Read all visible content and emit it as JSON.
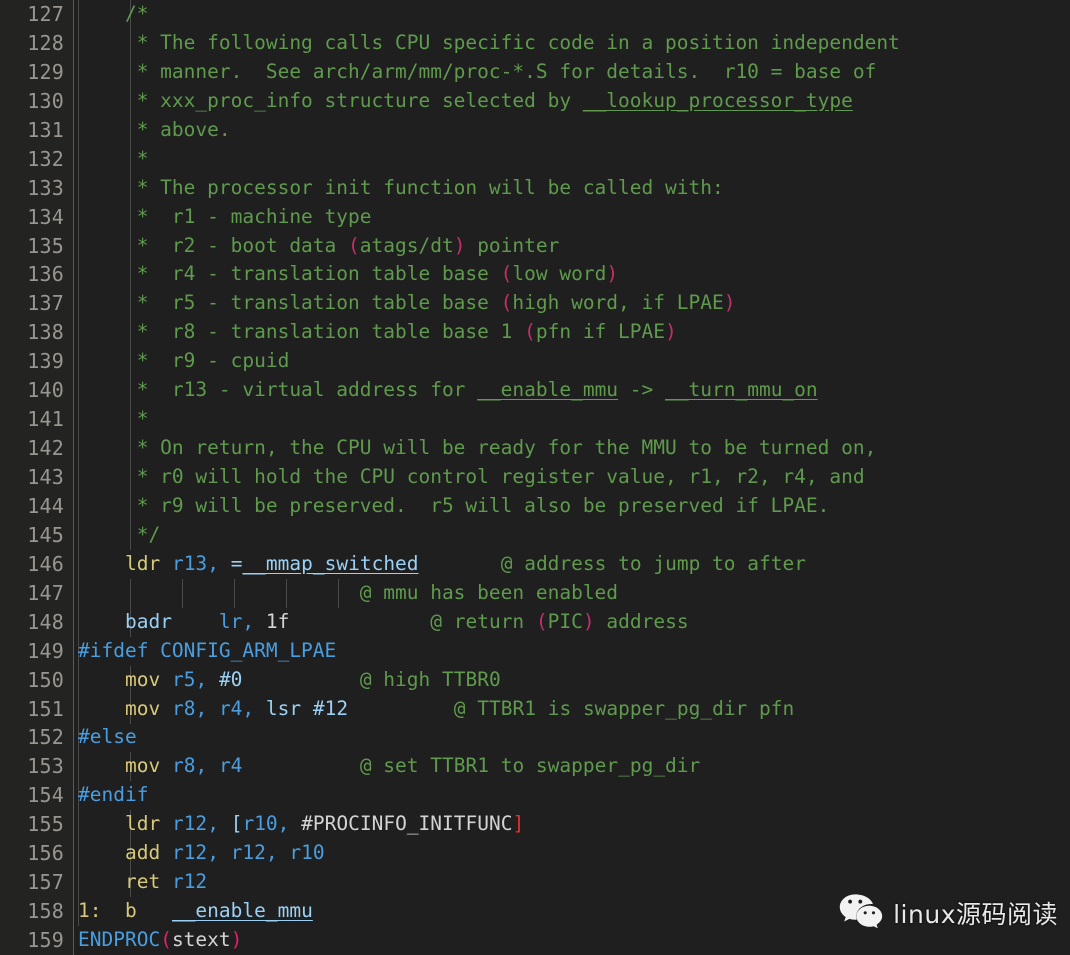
{
  "editor": {
    "theme_background": "#1e1f1e",
    "gutter_background": "#232422",
    "first_line": 127,
    "last_line": 159,
    "colors": {
      "comment": "#5f9a4d",
      "keyword": "#4a9ee0",
      "mnemonic": "#d8c97a",
      "register": "#4a9ee0",
      "identifier": "#9bd0f5",
      "paren_crimson": "#e0216b",
      "bracket_red": "#e03131",
      "plain": "#d4d4d4",
      "line_number": "#999691"
    }
  },
  "line_numbers": [
    127,
    128,
    129,
    130,
    131,
    132,
    133,
    134,
    135,
    136,
    137,
    138,
    139,
    140,
    141,
    142,
    143,
    144,
    145,
    146,
    147,
    148,
    149,
    150,
    151,
    152,
    153,
    154,
    155,
    156,
    157,
    158,
    159
  ],
  "lines": [
    {
      "n": 127,
      "text": "    /*"
    },
    {
      "n": 128,
      "text": "     * The following calls CPU specific code in a position independent"
    },
    {
      "n": 129,
      "text": "     * manner.  See arch/arm/mm/proc-*.S for details.  r10 = base of"
    },
    {
      "n": 130,
      "text": "     * xxx_proc_info structure selected by __lookup_processor_type"
    },
    {
      "n": 131,
      "text": "     * above."
    },
    {
      "n": 132,
      "text": "     *"
    },
    {
      "n": 133,
      "text": "     * The processor init function will be called with:"
    },
    {
      "n": 134,
      "text": "     *  r1 - machine type"
    },
    {
      "n": 135,
      "text": "     *  r2 - boot data (atags/dt) pointer"
    },
    {
      "n": 136,
      "text": "     *  r4 - translation table base (low word)"
    },
    {
      "n": 137,
      "text": "     *  r5 - translation table base (high word, if LPAE)"
    },
    {
      "n": 138,
      "text": "     *  r8 - translation table base 1 (pfn if LPAE)"
    },
    {
      "n": 139,
      "text": "     *  r9 - cpuid"
    },
    {
      "n": 140,
      "text": "     *  r13 - virtual address for __enable_mmu -> __turn_mmu_on"
    },
    {
      "n": 141,
      "text": "     *"
    },
    {
      "n": 142,
      "text": "     * On return, the CPU will be ready for the MMU to be turned on,"
    },
    {
      "n": 143,
      "text": "     * r0 will hold the CPU control register value, r1, r2, r4, and"
    },
    {
      "n": 144,
      "text": "     * r9 will be preserved.  r5 will also be preserved if LPAE."
    },
    {
      "n": 145,
      "text": "     */"
    },
    {
      "n": 146,
      "text": "    ldr r13, =__mmap_switched     @ address to jump to after"
    },
    {
      "n": 147,
      "text": "                      @ mmu has been enabled"
    },
    {
      "n": 148,
      "text": "    badr    lr, 1f            @ return (PIC) address"
    },
    {
      "n": 149,
      "text": "#ifdef CONFIG_ARM_LPAE"
    },
    {
      "n": 150,
      "text": "    mov r5, #0          @ high TTBR0"
    },
    {
      "n": 151,
      "text": "    mov r8, r4, lsr #12         @ TTBR1 is swapper_pg_dir pfn"
    },
    {
      "n": 152,
      "text": "#else"
    },
    {
      "n": 153,
      "text": "    mov r8, r4          @ set TTBR1 to swapper_pg_dir"
    },
    {
      "n": 154,
      "text": "#endif"
    },
    {
      "n": 155,
      "text": "    ldr r12, [r10, #PROCINFO_INITFUNC]"
    },
    {
      "n": 156,
      "text": "    add r12, r12, r10"
    },
    {
      "n": 157,
      "text": "    ret r12"
    },
    {
      "n": 158,
      "text": "1:  b   __enable_mmu"
    },
    {
      "n": 159,
      "text": "ENDPROC(stext)"
    }
  ],
  "watermark": {
    "icon": "wechat-icon",
    "label": "linux源码阅读"
  }
}
